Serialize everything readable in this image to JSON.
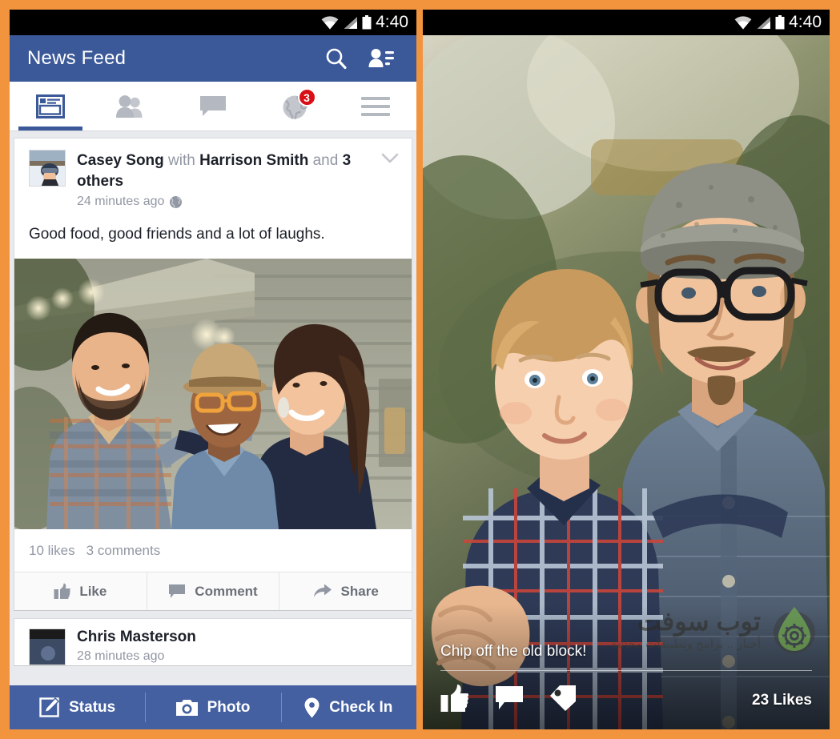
{
  "theme": {
    "page_background": "#F2943E",
    "fb_blue": "#3b5998",
    "composer_blue": "#4460a0",
    "badge_red": "#d80f16",
    "feed_gray": "#e9eaed",
    "meta_gray": "#9197a3",
    "text_dark": "#1d2129",
    "watermark_green": "#7dc242"
  },
  "left_phone": {
    "statusbar": {
      "time": "4:40",
      "icons": [
        "wifi-icon",
        "cellular-signal-icon",
        "battery-icon"
      ]
    },
    "header": {
      "title": "News Feed",
      "actions": [
        {
          "name": "search-icon",
          "label": "Search"
        },
        {
          "name": "friend-requests-icon",
          "label": "Friend Requests"
        }
      ]
    },
    "tabs": [
      {
        "name": "tab-news-feed",
        "icon": "news-feed-icon",
        "active": true,
        "badge": ""
      },
      {
        "name": "tab-friends",
        "icon": "friends-icon",
        "active": false,
        "badge": ""
      },
      {
        "name": "tab-messages",
        "icon": "messages-icon",
        "active": false,
        "badge": ""
      },
      {
        "name": "tab-notifications",
        "icon": "globe-icon",
        "active": false,
        "badge": "3"
      },
      {
        "name": "tab-more",
        "icon": "hamburger-icon",
        "active": false,
        "badge": ""
      }
    ],
    "post": {
      "author": "Casey Song",
      "with_word": "with",
      "tagged": "Harrison Smith",
      "and_word": "and",
      "others": "3 others",
      "timestamp": "24 minutes ago",
      "privacy_icon": "globe-icon",
      "menu_icon": "chevron-down-icon",
      "body": "Good food, good friends and a lot of laughs.",
      "photo_alt": "Three friends laughing together on a porch",
      "avatar_alt": "Skier in helmet and goggles",
      "likes": "10 likes",
      "comments": "3 comments",
      "actions": [
        {
          "name": "like-button",
          "icon": "thumbs-up-icon",
          "label": "Like"
        },
        {
          "name": "comment-button",
          "icon": "comment-bubble-icon",
          "label": "Comment"
        },
        {
          "name": "share-button",
          "icon": "share-arrow-icon",
          "label": "Share"
        }
      ]
    },
    "next_post": {
      "author": "Chris Masterson",
      "timestamp": "28 minutes ago"
    },
    "composer": [
      {
        "name": "status-button",
        "icon": "compose-pencil-icon",
        "label": "Status"
      },
      {
        "name": "photo-button",
        "icon": "camera-icon",
        "label": "Photo"
      },
      {
        "name": "check-in-button",
        "icon": "location-pin-icon",
        "label": "Check In"
      }
    ]
  },
  "right_phone": {
    "statusbar": {
      "time": "4:40",
      "icons": [
        "wifi-icon",
        "cellular-signal-icon",
        "battery-icon"
      ]
    },
    "photo_alt": "Man in flat cap and glasses holding a blond toddler in plaid shirt",
    "caption": "Chip off the old block!",
    "likes": "23 Likes",
    "actions": [
      {
        "name": "like-button",
        "icon": "thumbs-up-icon"
      },
      {
        "name": "comment-button",
        "icon": "comment-bubble-icon"
      },
      {
        "name": "tag-button",
        "icon": "tag-icon"
      }
    ],
    "watermark": {
      "title": "توب سوفت",
      "subtitle": "أخبار .. برامج وتطبيقات مجانية",
      "logo": "green-droplet-gear-icon"
    }
  }
}
